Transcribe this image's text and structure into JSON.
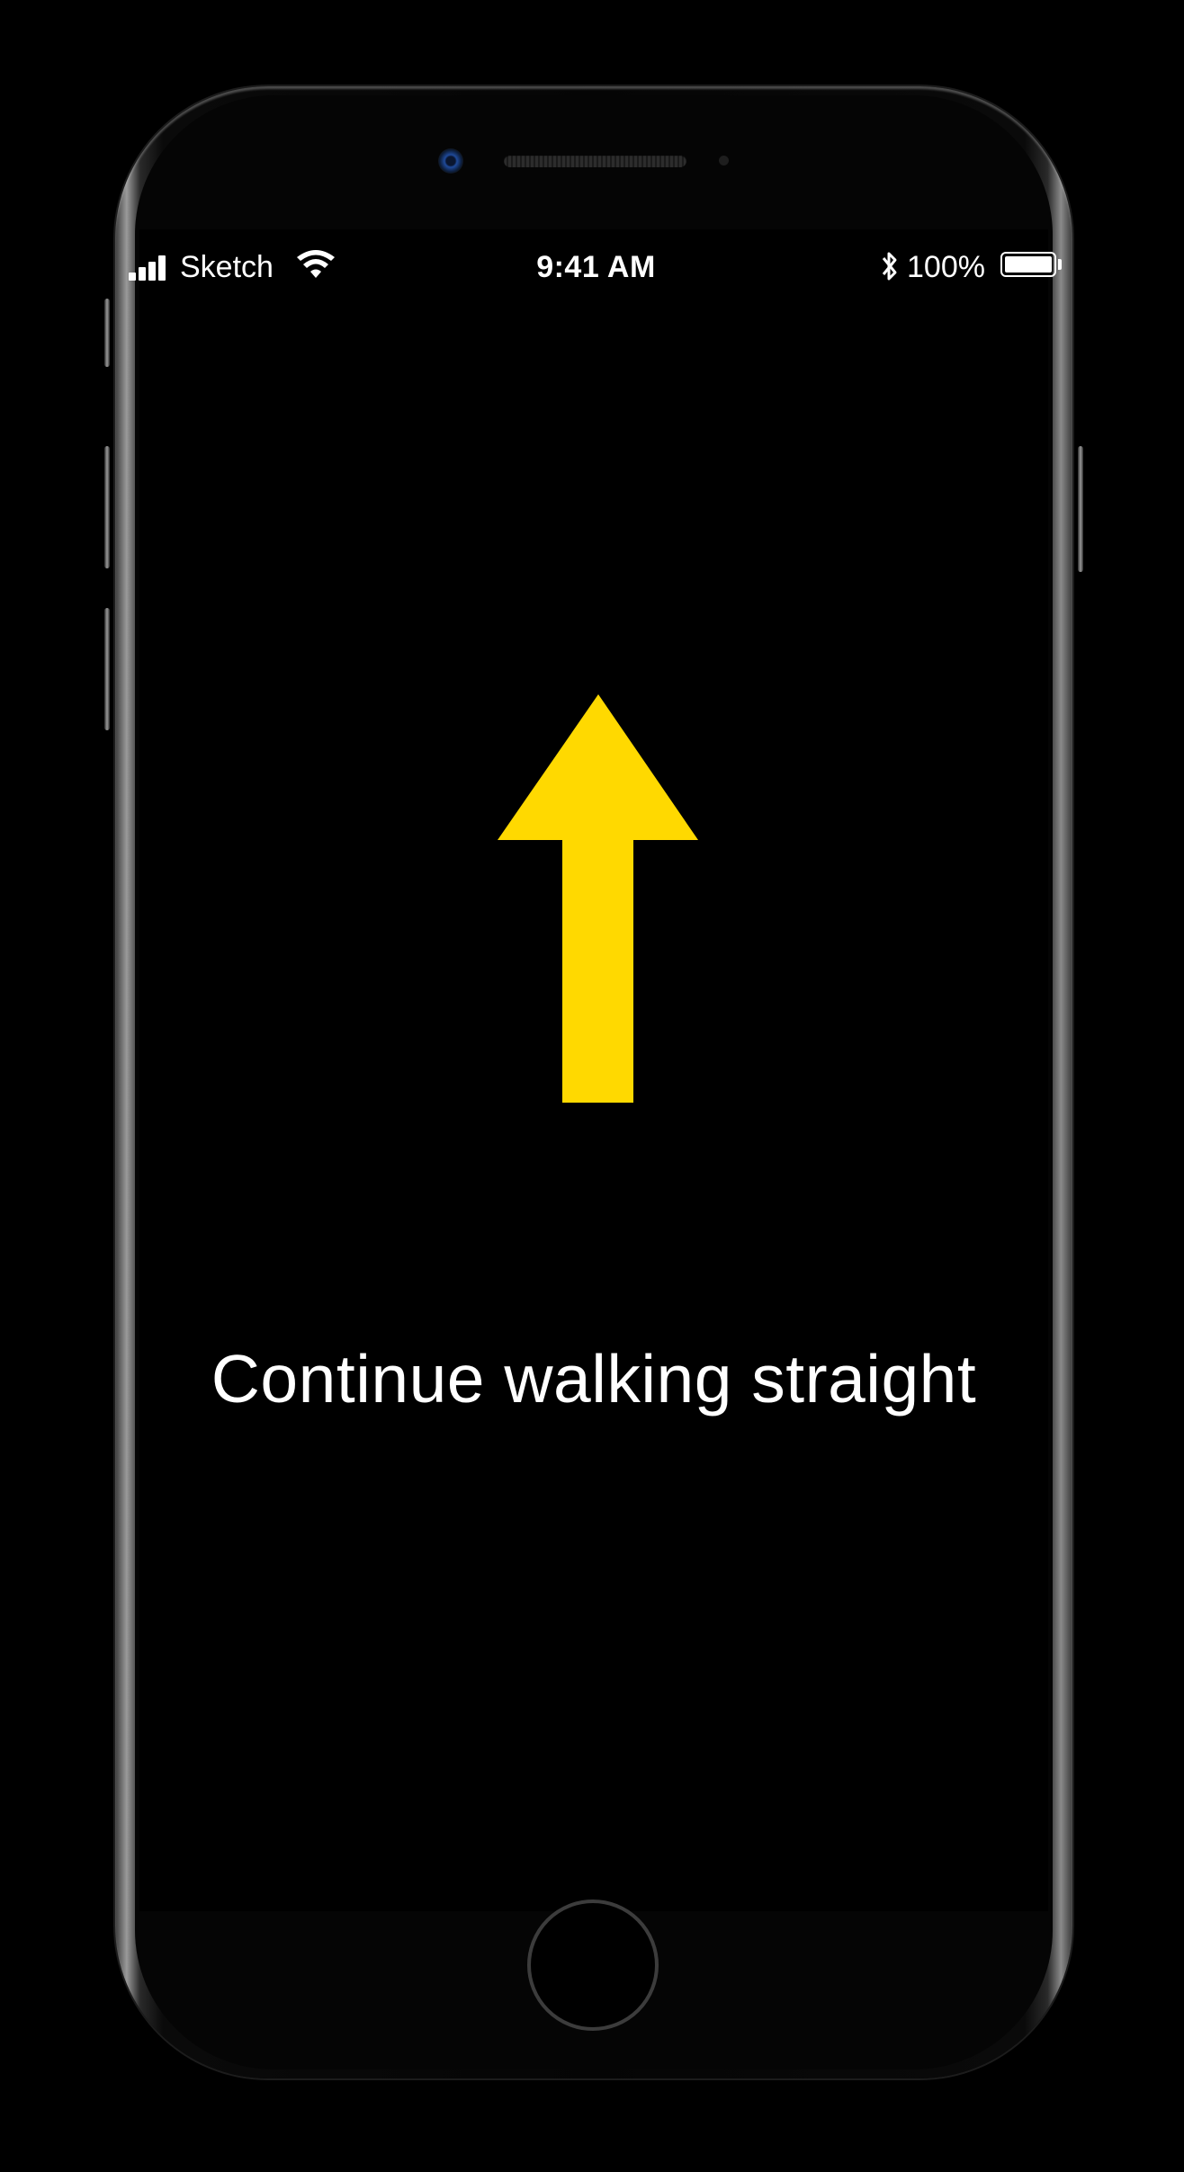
{
  "status_bar": {
    "carrier": "Sketch",
    "time": "9:41 AM",
    "battery_percent": "100%",
    "icons": [
      "signal-icon",
      "wifi-icon",
      "bluetooth-icon",
      "battery-icon"
    ]
  },
  "navigation": {
    "direction_icon": "arrow-up-icon",
    "arrow_color": "#FFD900",
    "instruction": "Continue walking straight"
  },
  "colors": {
    "background": "#000000",
    "text": "#FFFFFF",
    "accent": "#FFD900"
  }
}
